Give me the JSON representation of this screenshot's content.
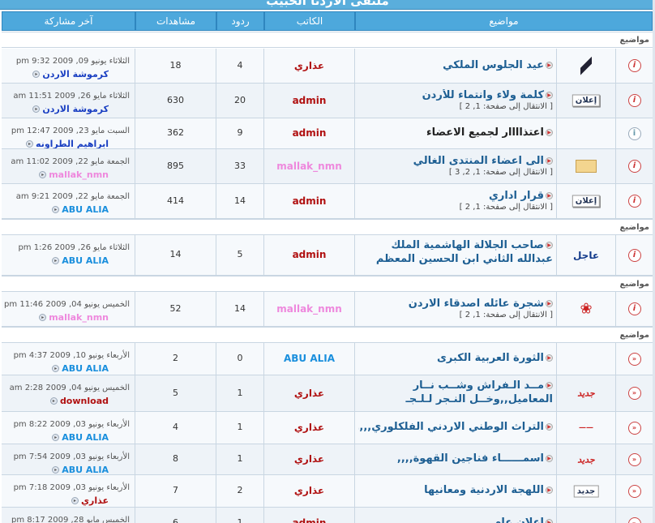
{
  "forum": {
    "title": "ملتقى الاردنا الحبيب"
  },
  "columns": {
    "topics": "مواضيع",
    "author": "الكاتب",
    "replies": "ردود",
    "views": "مشاهدات",
    "last_post": "آخر مشاركة"
  },
  "sections": [
    "مواضيع",
    "مواضيع",
    "مواضيع",
    "مواضيع"
  ],
  "rows": [
    {
      "title": "عيد الجلوس الملكي",
      "pages_label": "",
      "author": "عذاري",
      "author_color": "#b01010",
      "replies": "4",
      "views": "18",
      "last_date": "الثلاثاء يونيو 09, 2009 9:32 pm",
      "last_user": "كرموشة الاردن",
      "last_user_color": "#1a3fc2",
      "icon": "pen-icon",
      "status": "info"
    },
    {
      "title": "كلمة ولاء وانتماء للأردن",
      "pages_label": "[ الانتقال إلى صفحة: 1, 2 ]",
      "author": "admin",
      "author_color": "#b01010",
      "replies": "20",
      "views": "630",
      "last_date": "الثلاثاء مايو 26, 2009 11:51 am",
      "last_user": "كرموشة الاردن",
      "last_user_color": "#1a3fc2",
      "icon": "announcement-badge",
      "status": "info"
    },
    {
      "title": "اعتذاااار لجميع الاعضاء",
      "pages_label": "",
      "author": "admin",
      "author_color": "#b01010",
      "replies": "9",
      "views": "362",
      "last_date": "السبت مايو 23, 2009 12:47 pm",
      "last_user": "ابراهيم الطراونه",
      "last_user_color": "#1a3fc2",
      "icon": "",
      "status": "plain"
    },
    {
      "title": "الى اعضاء المنتدى الغالي",
      "pages_label": "[ الانتقال إلى صفحة: 1, 2, 3 ]",
      "author": "mallak_nmn",
      "author_color": "#ee88dd",
      "replies": "33",
      "views": "895",
      "last_date": "الجمعة مايو 22, 2009 11:02 am",
      "last_user": "mallak_nmn",
      "last_user_color": "#ee88dd",
      "icon": "envelope-icon",
      "status": "info"
    },
    {
      "title": "قرار اداري",
      "pages_label": "[ الانتقال إلى صفحة: 1, 2 ]",
      "author": "admin",
      "author_color": "#b01010",
      "replies": "14",
      "views": "414",
      "last_date": "الجمعة مايو 22, 2009 9:21 am",
      "last_user": "ABU ALIA",
      "last_user_color": "#1a8fdd",
      "icon": "announcement-badge",
      "status": "info"
    },
    {
      "title": "صاحب الجلالة الهاشمية الملك عبدالله الثاني ابن الحسين المعظم",
      "pages_label": "",
      "author": "admin",
      "author_color": "#b01010",
      "replies": "5",
      "views": "14",
      "last_date": "الثلاثاء مايو 26, 2009 1:26 pm",
      "last_user": "ABU ALIA",
      "last_user_color": "#1a8fdd",
      "icon": "urgent-badge",
      "status": "info"
    },
    {
      "title": "شجرة عائله اصدقاء الاردن",
      "pages_label": "[ الانتقال إلى صفحة: 1, 2 ]",
      "author": "mallak_nmn",
      "author_color": "#ee88dd",
      "replies": "14",
      "views": "52",
      "last_date": "الخميس يونيو 04, 2009 11:46 pm",
      "last_user": "mallak_nmn",
      "last_user_color": "#ee88dd",
      "icon": "rose-icon",
      "status": "info"
    },
    {
      "title": "الثورة العربية الكبرى",
      "pages_label": "",
      "author": "ABU ALIA",
      "author_color": "#1a8fdd",
      "replies": "0",
      "views": "2",
      "last_date": "الأربعاء يونيو 10, 2009 4:37 pm",
      "last_user": "ABU ALIA",
      "last_user_color": "#1a8fdd",
      "icon": "",
      "status": "arrow"
    },
    {
      "title": "مــد الـفراش وشــب نــار المعاميل,,وخــل النـجر لـلـجـ",
      "pages_label": "",
      "author": "عذاري",
      "author_color": "#b01010",
      "replies": "1",
      "views": "5",
      "last_date": "الخميس يونيو 04, 2009 2:28 am",
      "last_user": "download",
      "last_user_color": "#b01010",
      "icon": "new-badge",
      "status": "arrow"
    },
    {
      "title": "التراث الوطني الاردني الفلكلوري,,,,",
      "pages_label": "",
      "author": "عذاري",
      "author_color": "#b01010",
      "replies": "1",
      "views": "4",
      "last_date": "الأربعاء يونيو 03, 2009 8:22 pm",
      "last_user": "ABU ALIA",
      "last_user_color": "#1a8fdd",
      "icon": "line-icon",
      "status": "arrow"
    },
    {
      "title": "اسمــــــاء فناجين القهوة,,,,",
      "pages_label": "",
      "author": "عذاري",
      "author_color": "#b01010",
      "replies": "1",
      "views": "8",
      "last_date": "الأربعاء يونيو 03, 2009 7:54 pm",
      "last_user": "ABU ALIA",
      "last_user_color": "#1a8fdd",
      "icon": "new-badge",
      "status": "arrow"
    },
    {
      "title": "اللهجة الاردنية ومعانيها",
      "pages_label": "",
      "author": "عذاري",
      "author_color": "#b01010",
      "replies": "2",
      "views": "7",
      "last_date": "الأربعاء يونيو 03, 2009 7:18 pm",
      "last_user": "عذاري",
      "last_user_color": "#b01010",
      "icon": "new-badge-boxed",
      "status": "arrow"
    },
    {
      "title": "اعلان عام",
      "pages_label": "",
      "author": "admin",
      "author_color": "#b01010",
      "replies": "1",
      "views": "6",
      "last_date": "الخميس مايو 28, 2009 8:17 pm",
      "last_user": "",
      "last_user_color": "#1a8fdd",
      "icon": "",
      "status": "arrow"
    }
  ],
  "badges": {
    "announcement": "إعلان",
    "urgent": "عاجل",
    "new": "جديد"
  },
  "colors": {
    "header_bg": "#4da8dc",
    "row_bg": "#eef3f8",
    "link": "#1e5f93"
  }
}
